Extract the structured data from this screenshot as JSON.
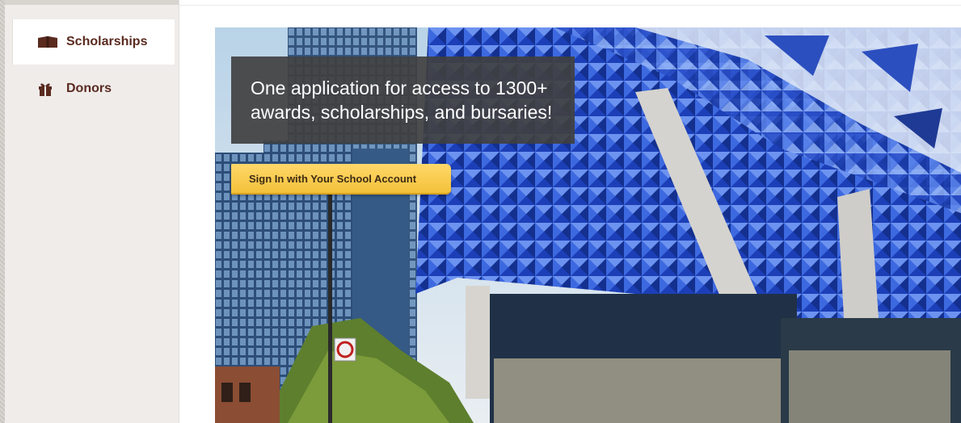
{
  "sidebar": {
    "items": [
      {
        "label": "Scholarships",
        "icon": "book-icon",
        "active": true
      },
      {
        "label": "Donors",
        "icon": "gift-icon",
        "active": false
      }
    ]
  },
  "hero": {
    "tagline_line1": "One application for access to 1300+",
    "tagline_line2": "awards, scholarships, and bursaries!",
    "signin_label": "Sign In with Your School Account"
  },
  "colors": {
    "brand": "#5a2a1f",
    "button": "#f3c13a",
    "tagline_bg": "#404040"
  }
}
